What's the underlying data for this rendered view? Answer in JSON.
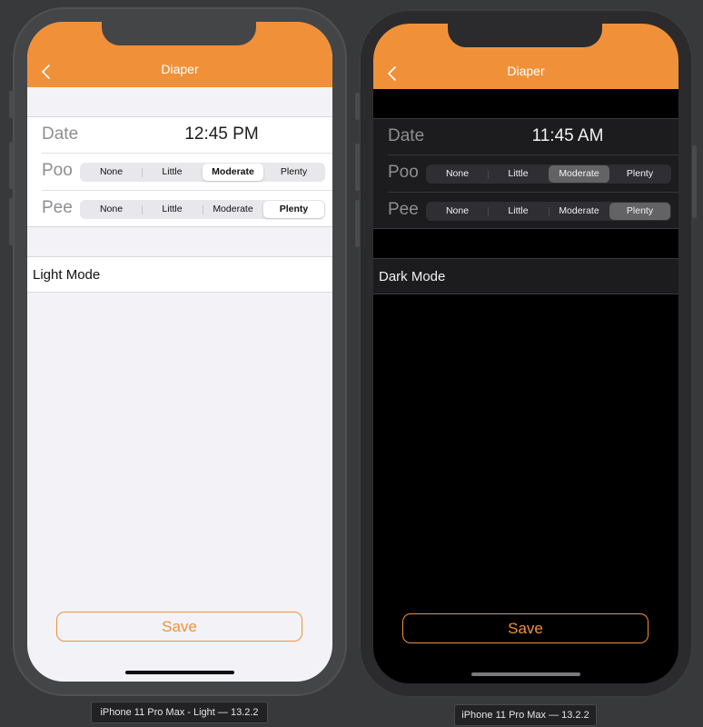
{
  "colors": {
    "accent": "#f0913a",
    "light_background": "#f2f2f7",
    "dark_background": "#000000",
    "dark_cell": "#1c1c1e"
  },
  "devices": [
    {
      "theme": "light",
      "nav": {
        "title": "Diaper",
        "back_icon": "chevron-left-icon"
      },
      "form": {
        "date_label": "Date",
        "time_value": "12:45 PM",
        "poo_label": "Poo",
        "pee_label": "Pee",
        "poo_options": [
          "None",
          "Little",
          "Moderate",
          "Plenty"
        ],
        "poo_selected": "Moderate",
        "pee_options": [
          "None",
          "Little",
          "Moderate",
          "Plenty"
        ],
        "pee_selected": "Plenty"
      },
      "mode_label": "Light Mode",
      "save_label": "Save",
      "device_label": "iPhone 11 Pro Max - Light — 13.2.2"
    },
    {
      "theme": "dark",
      "nav": {
        "title": "Diaper",
        "back_icon": "chevron-left-icon"
      },
      "form": {
        "date_label": "Date",
        "time_value": "11:45 AM",
        "poo_label": "Poo",
        "pee_label": "Pee",
        "poo_options": [
          "None",
          "Little",
          "Moderate",
          "Plenty"
        ],
        "poo_selected": "Moderate",
        "pee_options": [
          "None",
          "Little",
          "Moderate",
          "Plenty"
        ],
        "pee_selected": "Plenty"
      },
      "mode_label": "Dark Mode",
      "save_label": "Save",
      "device_label": "iPhone 11 Pro Max — 13.2.2"
    }
  ]
}
